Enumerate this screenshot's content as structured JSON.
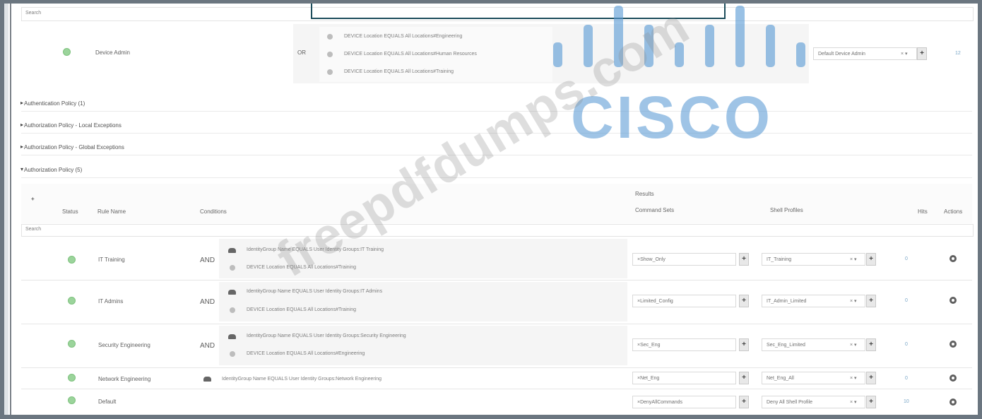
{
  "top_search": {
    "placeholder": "Search"
  },
  "device_admin_rule": {
    "name": "Device Admin",
    "operator": "OR",
    "conditions": [
      "DEVICE Location EQUALS All Locations#Engineering",
      "DEVICE Location EQUALS All Locations#Human Resources",
      "DEVICE Location EQUALS All Locations#Training"
    ],
    "result": "Default Device Admin",
    "hits": "12"
  },
  "sections": [
    {
      "label": "Authentication Policy (1)",
      "expanded": false
    },
    {
      "label": "Authorization Policy - Local Exceptions",
      "expanded": false
    },
    {
      "label": "Authorization Policy - Global Exceptions",
      "expanded": false
    },
    {
      "label": "Authorization Policy (5)",
      "expanded": true
    }
  ],
  "table": {
    "add_symbol": "+",
    "headers": {
      "status": "Status",
      "rule_name": "Rule Name",
      "conditions": "Conditions",
      "results": "Results",
      "command_sets": "Command Sets",
      "shell_profiles": "Shell Profiles",
      "hits": "Hits",
      "actions": "Actions"
    },
    "search_placeholder": "Search",
    "rows": [
      {
        "name": "IT Training",
        "operator": "AND",
        "conditions": [
          "IdentityGroup Name EQUALS User Identity Groups:IT Training",
          "DEVICE Location EQUALS All Locations#Training"
        ],
        "command_set": "×Show_Only",
        "shell_profile": "IT_Training",
        "hits": "0"
      },
      {
        "name": "IT Admins",
        "operator": "AND",
        "conditions": [
          "IdentityGroup Name EQUALS User Identity Groups:IT Admins",
          "DEVICE Location EQUALS All Locations#Training"
        ],
        "command_set": "×Limited_Config",
        "shell_profile": "IT_Admin_Limited",
        "hits": "0"
      },
      {
        "name": "Security Engineering",
        "operator": "AND",
        "conditions": [
          "IdentityGroup Name EQUALS User Identity Groups:Security Engineering",
          "DEVICE Location EQUALS All Locations#Engineering"
        ],
        "command_set": "×Sec_Eng",
        "shell_profile": "Sec_Eng_Limited",
        "hits": "0"
      },
      {
        "name": "Network Engineering",
        "operator": "",
        "conditions": [
          "IdentityGroup Name EQUALS User Identity Groups:Network Engineering"
        ],
        "command_set": "×Net_Eng",
        "shell_profile": "Net_Eng_All",
        "hits": "0"
      },
      {
        "name": "Default",
        "operator": "",
        "conditions": [],
        "command_set": "×DenyAllCommands",
        "shell_profile": "Deny All Shell Profile",
        "hits": "10"
      }
    ]
  },
  "dropdown_glyph": "× ▾",
  "overlay": {
    "brand": "CISCO",
    "watermark": "freepdfdumps.com"
  },
  "colors": {
    "accent": "#5b9bd5",
    "status_green": "#9bd49b",
    "border": "#6b7680"
  }
}
